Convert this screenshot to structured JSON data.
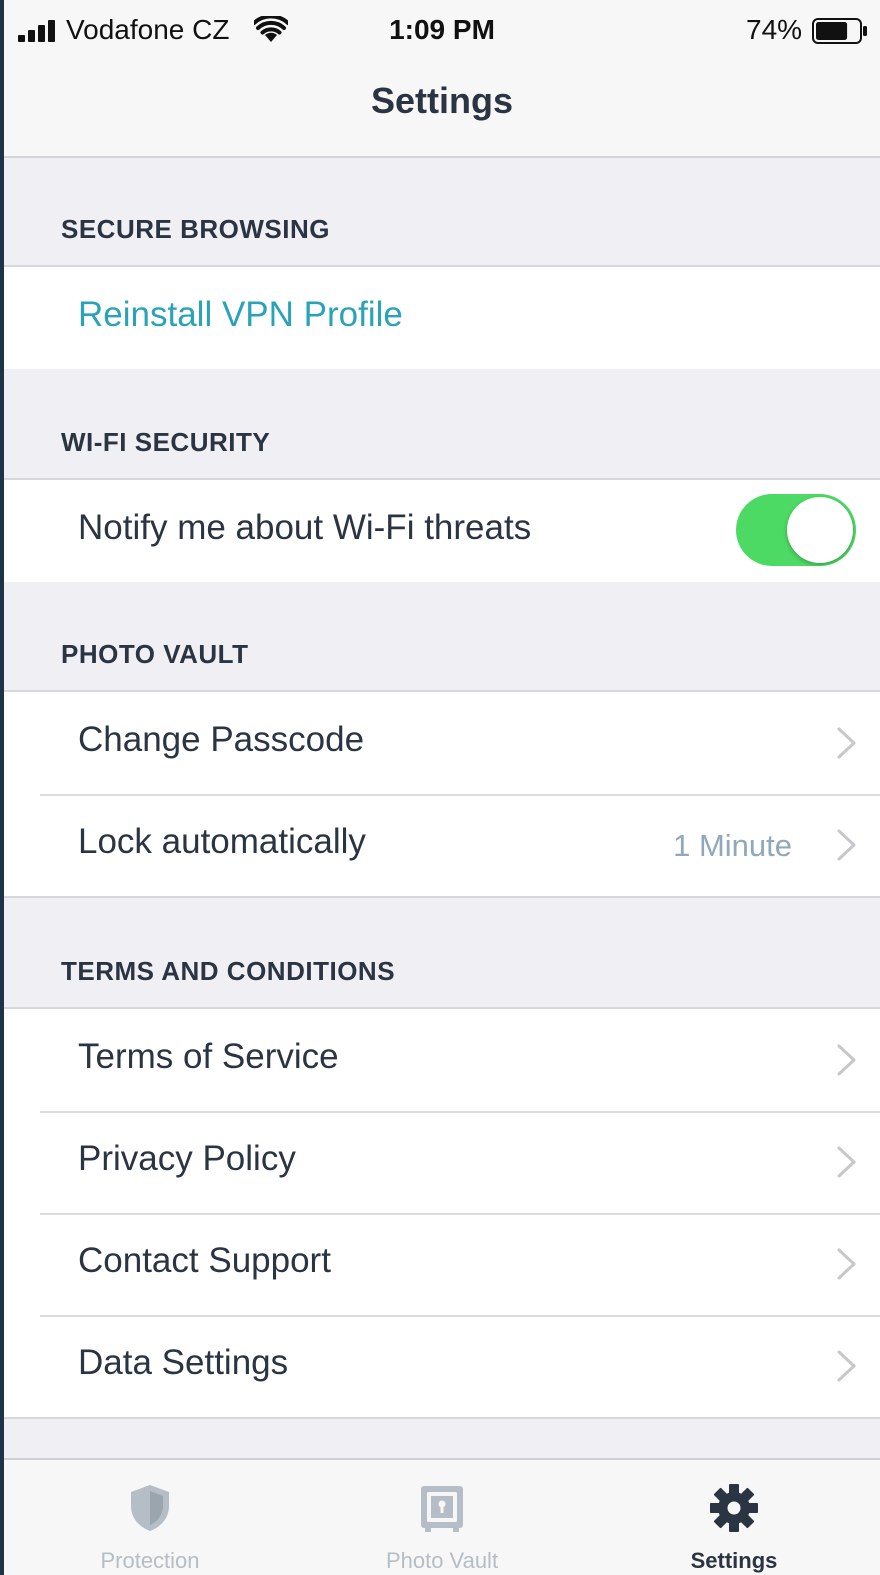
{
  "status_bar": {
    "carrier": "Vodafone CZ",
    "time": "1:09 PM",
    "battery_percent": "74%",
    "battery_level": 0.74
  },
  "nav": {
    "title": "Settings"
  },
  "sections": {
    "secure_browsing": {
      "header": "SECURE BROWSING",
      "reinstall_vpn": "Reinstall VPN Profile"
    },
    "wifi_security": {
      "header": "WI-FI SECURITY",
      "notify_label": "Notify me about Wi-Fi threats",
      "notify_enabled": true
    },
    "photo_vault": {
      "header": "PHOTO VAULT",
      "change_passcode": "Change Passcode",
      "lock_automatically": "Lock automatically",
      "lock_value": "1 Minute"
    },
    "terms": {
      "header": "TERMS AND CONDITIONS",
      "terms_of_service": "Terms of Service",
      "privacy_policy": "Privacy Policy",
      "contact_support": "Contact Support",
      "data_settings": "Data Settings"
    }
  },
  "tab_bar": {
    "tabs": [
      {
        "label": "Protection",
        "icon": "shield-icon",
        "active": false
      },
      {
        "label": "Photo Vault",
        "icon": "vault-icon",
        "active": false
      },
      {
        "label": "Settings",
        "icon": "gear-icon",
        "active": true
      }
    ]
  },
  "colors": {
    "accent_link": "#2aa3b8",
    "toggle_on": "#4cd964",
    "text_primary": "#2a3442",
    "tab_inactive": "#b5bec6"
  }
}
